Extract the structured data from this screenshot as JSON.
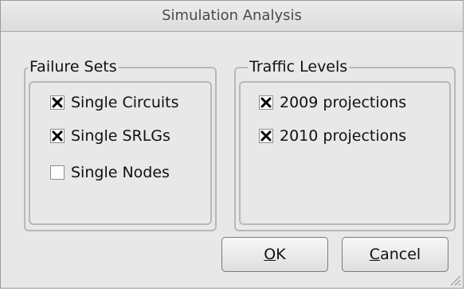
{
  "window": {
    "title": "Simulation Analysis"
  },
  "failure_sets": {
    "legend": "Failure Sets",
    "items": [
      {
        "label": "Single Circuits",
        "checked": true
      },
      {
        "label": "Single SRLGs",
        "checked": true
      },
      {
        "label": "Single Nodes",
        "checked": false
      }
    ]
  },
  "traffic_levels": {
    "legend": "Traffic Levels",
    "items": [
      {
        "label": "2009 projections",
        "checked": true
      },
      {
        "label": "2010 projections",
        "checked": true
      }
    ]
  },
  "buttons": {
    "ok_mnemonic": "O",
    "ok_rest": "K",
    "cancel_mnemonic": "C",
    "cancel_rest": "ancel"
  },
  "icons": {
    "check": "x-mark-icon",
    "resize": "resize-grip-icon"
  }
}
